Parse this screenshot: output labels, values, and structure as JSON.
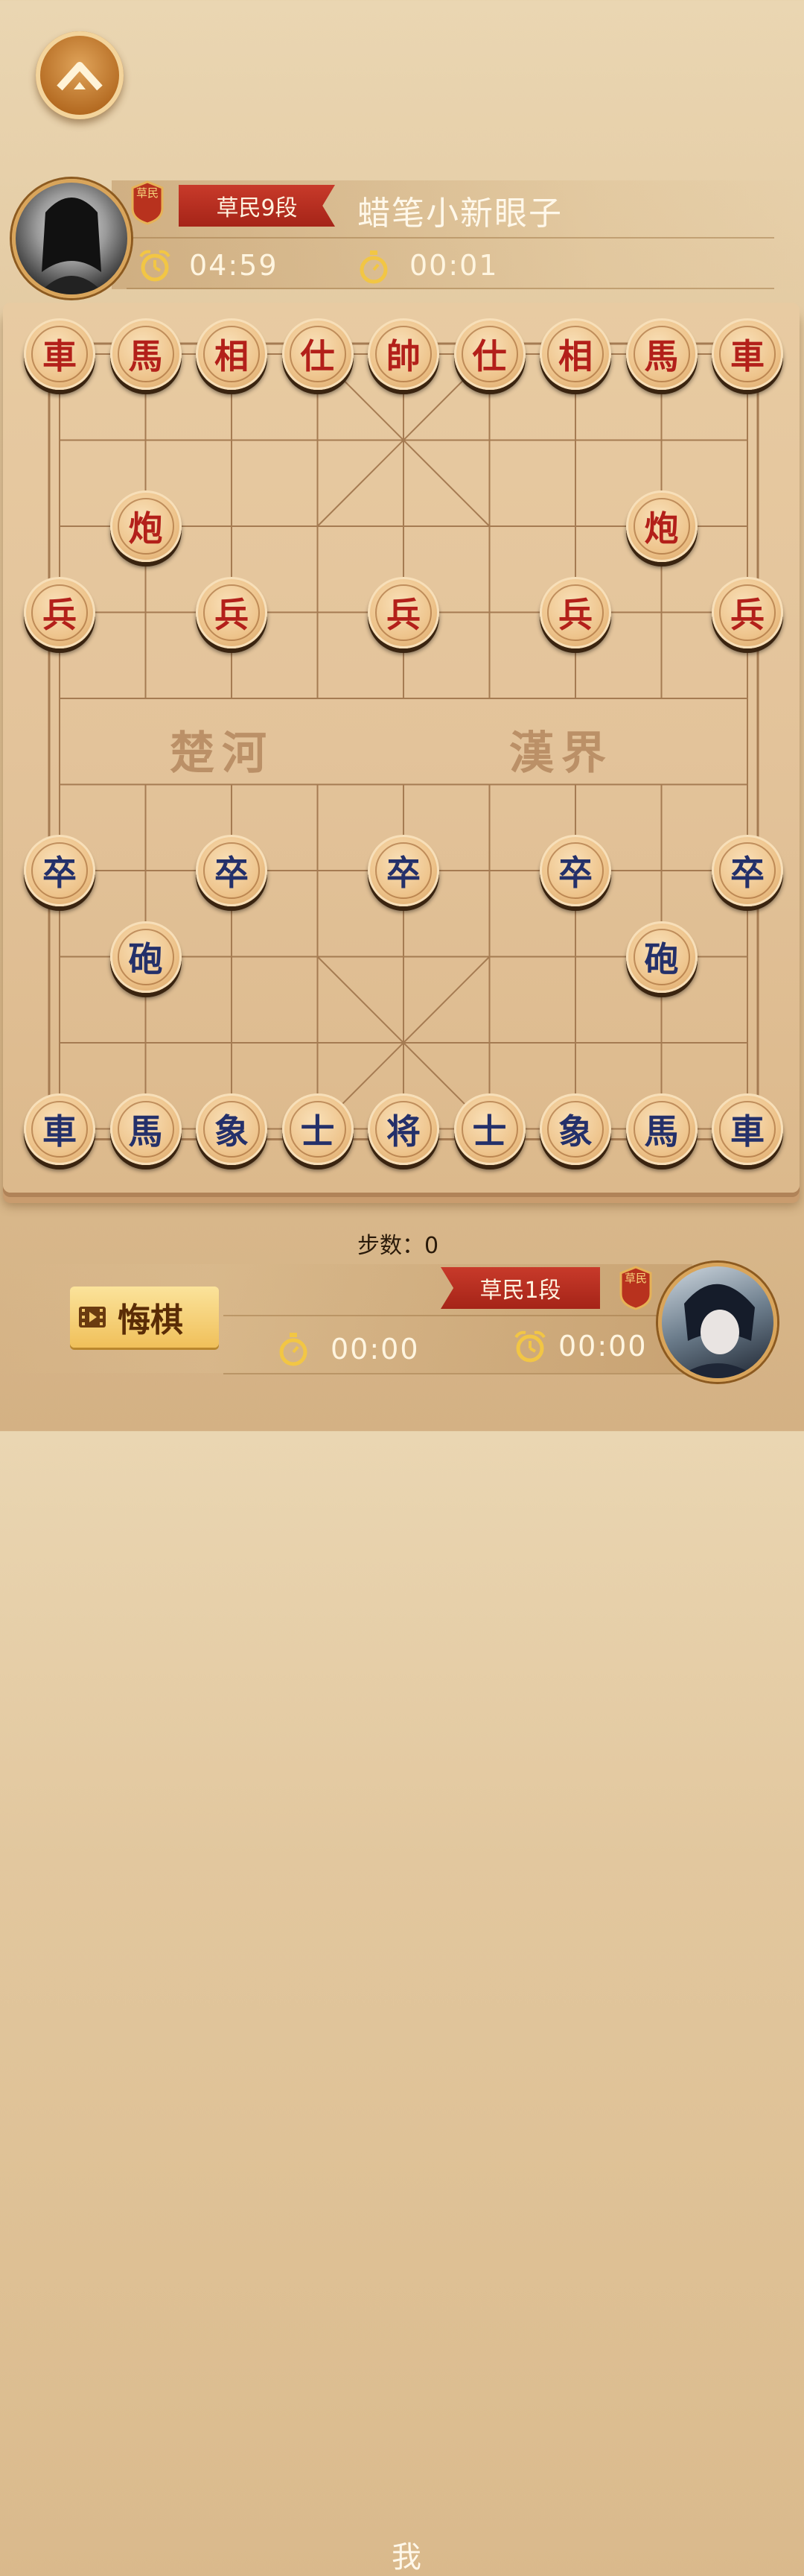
{
  "top_player": {
    "rank_badge": "草民",
    "rank": "草民9段",
    "name": "蜡笔小新眼子",
    "total_time": "04:59",
    "move_time": "00:01"
  },
  "bottom_player": {
    "me_label": "我",
    "rank_badge": "草民",
    "rank": "草民1段",
    "total_time": "00:00",
    "move_time": "00:00"
  },
  "steps_label": "步数：0",
  "undo_label": "悔棋",
  "river": {
    "left": "楚河",
    "right": "漢界"
  },
  "pieces": {
    "red_back_row": [
      "車",
      "馬",
      "相",
      "仕",
      "帥",
      "仕",
      "相",
      "馬",
      "車"
    ],
    "red_cannon": "炮",
    "red_soldier": "兵",
    "blue_back_row": [
      "車",
      "馬",
      "象",
      "士",
      "将",
      "士",
      "象",
      "馬",
      "車"
    ],
    "blue_cannon": "砲",
    "blue_soldier": "卒"
  },
  "colors": {
    "red_piece_text": "#b3201a",
    "blue_piece_text": "#24306a",
    "rank_tag": "#b52a1c"
  }
}
